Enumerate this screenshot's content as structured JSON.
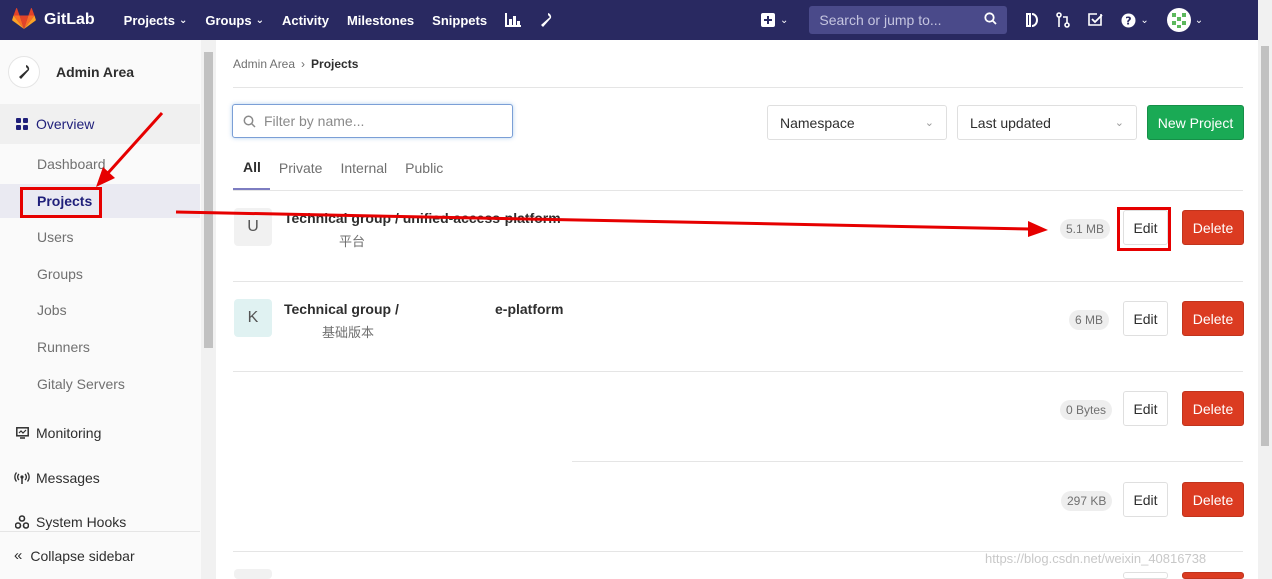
{
  "navbar": {
    "brand": "GitLab",
    "items": [
      {
        "label": "Projects",
        "chevron": true
      },
      {
        "label": "Groups",
        "chevron": true
      },
      {
        "label": "Activity",
        "chevron": false
      },
      {
        "label": "Milestones",
        "chevron": false
      },
      {
        "label": "Snippets",
        "chevron": false
      }
    ],
    "search_placeholder": "Search or jump to..."
  },
  "sidebar": {
    "title": "Admin Area",
    "overview_label": "Overview",
    "overview_items": [
      "Dashboard",
      "Projects",
      "Users",
      "Groups",
      "Jobs",
      "Runners",
      "Gitaly Servers"
    ],
    "monitoring_label": "Monitoring",
    "messages_label": "Messages",
    "system_hooks_label": "System Hooks",
    "collapse_label": "Collapse sidebar"
  },
  "breadcrumb": {
    "parent": "Admin Area",
    "separator": "›",
    "current": "Projects"
  },
  "toolbar": {
    "filter_placeholder": "Filter by name...",
    "namespace_label": "Namespace",
    "sort_label": "Last updated",
    "new_project_label": "New Project"
  },
  "tabs": [
    "All",
    "Private",
    "Internal",
    "Public"
  ],
  "projects": [
    {
      "avatar": "U",
      "name": "Technical group / unified-access-platform",
      "desc": "平台",
      "size": "5.1 MB",
      "edit": "Edit",
      "delete": "Delete"
    },
    {
      "avatar": "K",
      "name_left": "Technical group /",
      "name_right": "e-platform",
      "desc": "基础版本",
      "size": "6 MB",
      "edit": "Edit",
      "delete": "Delete"
    },
    {
      "size": "0 Bytes",
      "edit": "Edit",
      "delete": "Delete"
    },
    {
      "size": "297 KB",
      "edit": "Edit",
      "delete": "Delete"
    }
  ],
  "watermark": "https://blog.csdn.net/weixin_40816738",
  "colors": {
    "navbar": "#292961",
    "new_button": "#1aaa55",
    "delete_button": "#db3b21",
    "annotation": "#e60000"
  }
}
